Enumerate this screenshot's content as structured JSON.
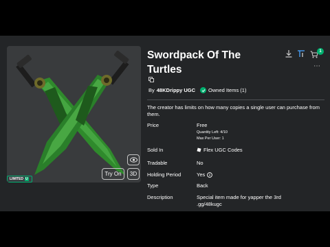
{
  "item": {
    "title": "Swordpack Of The Turtles",
    "by_prefix": "By",
    "creator": "48KDrippy UGC",
    "owned": "Owned Items (1)",
    "description": "The creator has limits on how many copies a single user can purchase from them."
  },
  "preview": {
    "limited_label": "LIMITED",
    "limited_u": "U",
    "try_on_label": "Try On",
    "three_d_label": "3D"
  },
  "details": {
    "price_label": "Price",
    "price_value": "Free",
    "quantity_left": "Quantity Left: 4/10",
    "max_per_user": "Max Per User: 1",
    "sold_in_label": "Sold In",
    "sold_in_value": "Flex UGC Codes",
    "tradable_label": "Tradable",
    "tradable_value": "No",
    "holding_label": "Holding Period",
    "holding_value": "Yes",
    "type_label": "Type",
    "type_value": "Back",
    "description_label": "Description",
    "description_value": "Special item made for yapper the 3rd .gg/48kugc"
  },
  "header": {
    "cart_count": "1"
  },
  "colors": {
    "accent_green": "#00b06f",
    "panel_bg": "#393b3d",
    "page_bg": "#232527"
  }
}
